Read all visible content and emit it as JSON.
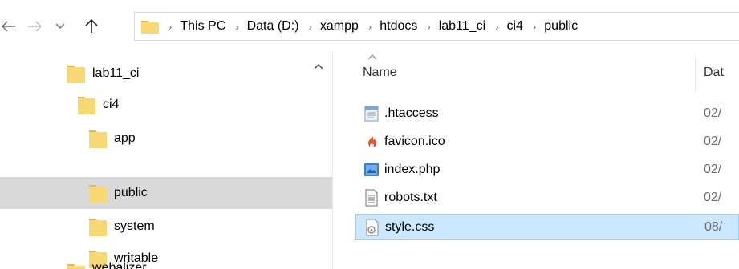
{
  "navigation": {
    "breadcrumbs": [
      "This PC",
      "Data (D:)",
      "xampp",
      "htdocs",
      "lab11_ci",
      "ci4",
      "public"
    ],
    "icons": {
      "back": "arrow-left-icon",
      "forward": "arrow-right-icon",
      "recent": "chevron-down-icon",
      "up": "arrow-up-icon"
    }
  },
  "tree": {
    "items": [
      {
        "label": "lab11_ci",
        "indent": 0,
        "selected": false
      },
      {
        "label": "ci4",
        "indent": 1,
        "selected": false
      },
      {
        "label": "app",
        "indent": 2,
        "selected": false
      },
      {
        "label": "public",
        "indent": 2,
        "selected": true
      },
      {
        "label": "system",
        "indent": 2,
        "selected": false
      },
      {
        "label": "writable",
        "indent": 2,
        "selected": false
      },
      {
        "label": "webalizer",
        "indent": 0,
        "selected": false
      }
    ]
  },
  "files": {
    "columns": {
      "name": "Name",
      "date": "Dat"
    },
    "rows": [
      {
        "name": ".htaccess",
        "date": "02/",
        "icon": "htaccess-file-icon",
        "selected": false
      },
      {
        "name": "favicon.ico",
        "date": "02/",
        "icon": "codeigniter-flame-icon",
        "selected": false
      },
      {
        "name": "index.php",
        "date": "02/",
        "icon": "php-file-icon",
        "selected": false
      },
      {
        "name": "robots.txt",
        "date": "02/",
        "icon": "text-file-icon",
        "selected": false
      },
      {
        "name": "style.css",
        "date": "08/",
        "icon": "css-file-icon",
        "selected": true
      }
    ]
  },
  "colors": {
    "folder": "#f8d775",
    "folder_dark": "#e0b84c",
    "tree_selected": "#d9d9d9",
    "row_selected": "#cce8ff",
    "row_selected_border": "#99d1ff",
    "flame": "#e2572d"
  }
}
